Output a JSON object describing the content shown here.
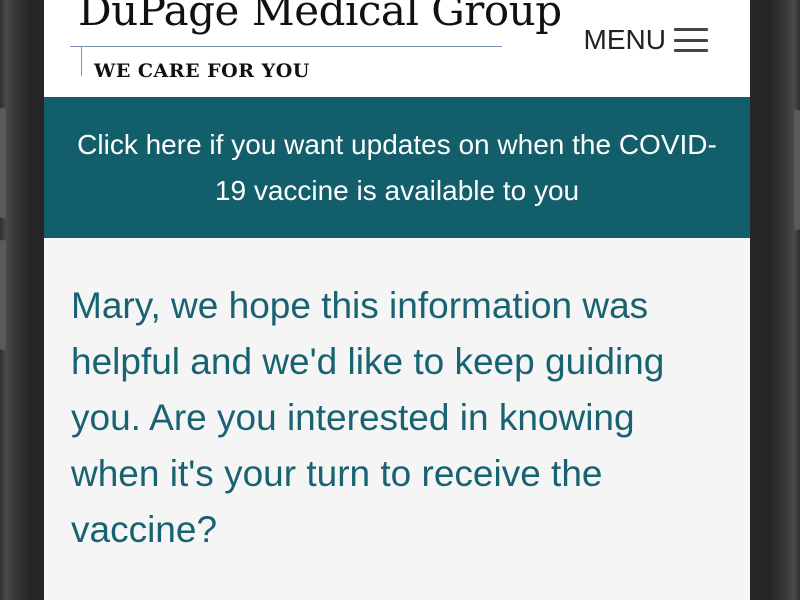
{
  "header": {
    "logo_name": "DuPage Medical Group",
    "logo_tagline": "WE CARE FOR YOU",
    "menu_label": "MENU",
    "menu_icon": "hamburger-icon"
  },
  "banner": {
    "text": "Click here if you want updates on when the COVID-19 vaccine is available to you"
  },
  "main": {
    "message": "Mary, we hope this information was helpful and we'd like to keep guiding you. Are you interested in knowing when it's your turn to receive the vaccine?"
  },
  "colors": {
    "banner_bg": "#125e6b",
    "message_text": "#186272",
    "header_bg": "#ffffff",
    "page_bg": "#f5f5f5"
  }
}
